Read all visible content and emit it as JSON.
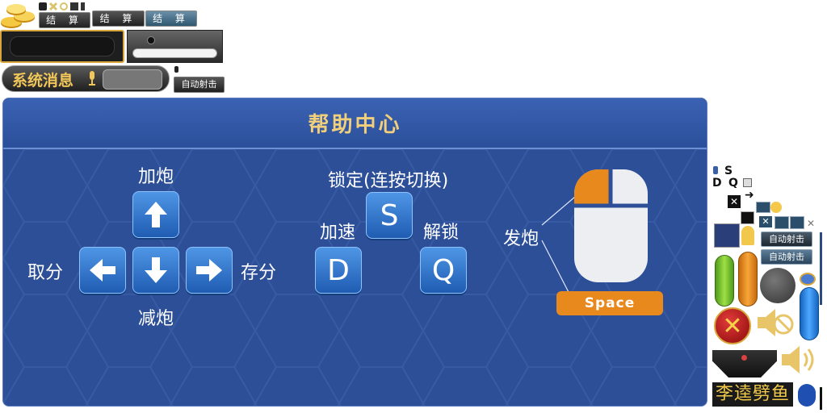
{
  "topbar": {
    "settle_buttons": [
      "结 算",
      "结 算",
      "结 算"
    ]
  },
  "system_message": {
    "label": "系统消息"
  },
  "auto_fire_labels": [
    "自动射击",
    "自动射击",
    "自动射击"
  ],
  "help": {
    "title": "帮助中心",
    "arrows": {
      "up_label": "加炮",
      "down_label": "减炮",
      "left_label": "取分",
      "right_label": "存分"
    },
    "keys": {
      "lock_label": "锁定(连按切换)",
      "lock_key": "S",
      "speed_label": "加速",
      "speed_key": "D",
      "unlock_label": "解锁",
      "unlock_key": "Q"
    },
    "mouse": {
      "fire_label": "发炮",
      "space_label": "Space"
    }
  },
  "side_sprites": {
    "letters": [
      "S",
      "D",
      "Q"
    ],
    "fish_name": "李逵劈鱼"
  },
  "colors": {
    "dialog_bg": "#2d4f98",
    "title_gold": "#f2cf7a",
    "key_blue": "#2f74cf",
    "accent_orange": "#e8891e"
  }
}
